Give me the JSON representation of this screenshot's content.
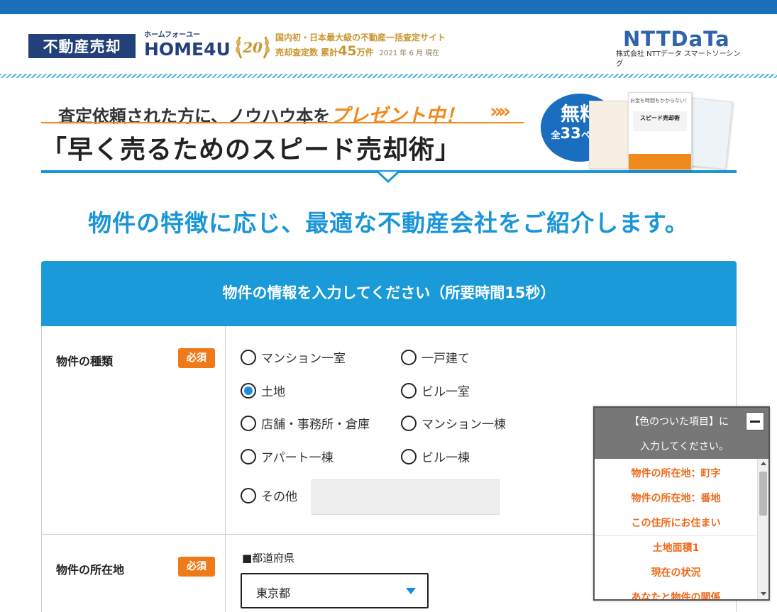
{
  "header": {
    "logo_label": "不動産売却",
    "brand_kana": "ホームフォーユー",
    "brand_name": "HOME4U",
    "anniversary_number": "20",
    "tagline_line1": "国内初・日本最大級の不動産一括査定サイト",
    "tagline_line2_prefix": "売却査定数 累計",
    "tagline_line2_count": "45",
    "tagline_line2_unit": "万件",
    "tagline_line2_date": "2021 年 6 月 現在",
    "ntt_brand": "NTTDaTa",
    "ntt_sub": "株式会社 NTTデータ スマートソーシング"
  },
  "banner": {
    "sub_prefix": "査定依頼された方に、ノウハウ本を",
    "sub_highlight": "プレゼント中！",
    "title": "「早く売るためのスピード売却術」",
    "free_label": "無料",
    "pages_prefix": "全",
    "pages_number": "33",
    "pages_suffix": "ページ",
    "book_tagline": "お金も時間もかからない！",
    "book_title": "スピード売却術"
  },
  "lead_text": "物件の特徴に応じ、最適な不動産会社をご紹介します。",
  "form": {
    "heading": "物件の情報を入力してください（所要時間15秒）",
    "required_label": "必須",
    "property_type": {
      "label": "物件の種類",
      "options": [
        {
          "label": "マンション一室",
          "selected": false
        },
        {
          "label": "一戸建て",
          "selected": false
        },
        {
          "label": "土地",
          "selected": true
        },
        {
          "label": "ビル一室",
          "selected": false
        },
        {
          "label": "店舗・事務所・倉庫",
          "selected": false
        },
        {
          "label": "マンション一棟",
          "selected": false
        },
        {
          "label": "アパート一棟",
          "selected": false
        },
        {
          "label": "ビル一棟",
          "selected": false
        },
        {
          "label": "その他",
          "selected": false
        }
      ],
      "other_value": ""
    },
    "location": {
      "label": "物件の所在地",
      "prefecture_label": "■都道府県",
      "prefecture_value": "東京都"
    }
  },
  "floating_panel": {
    "title_line1": "【色のついた項目】に",
    "title_line2": "入力してください。",
    "items": [
      "物件の所在地：町字",
      "物件の所在地：番地",
      "この住所にお住まい",
      "土地面積1",
      "現在の状況",
      "あなたと物件の関係"
    ]
  },
  "colors": {
    "accent_blue": "#1a9ad8",
    "required_orange": "#ee7a1a",
    "panel_item_orange": "#ee6a1a",
    "radio_selected": "#1a8ce0"
  }
}
